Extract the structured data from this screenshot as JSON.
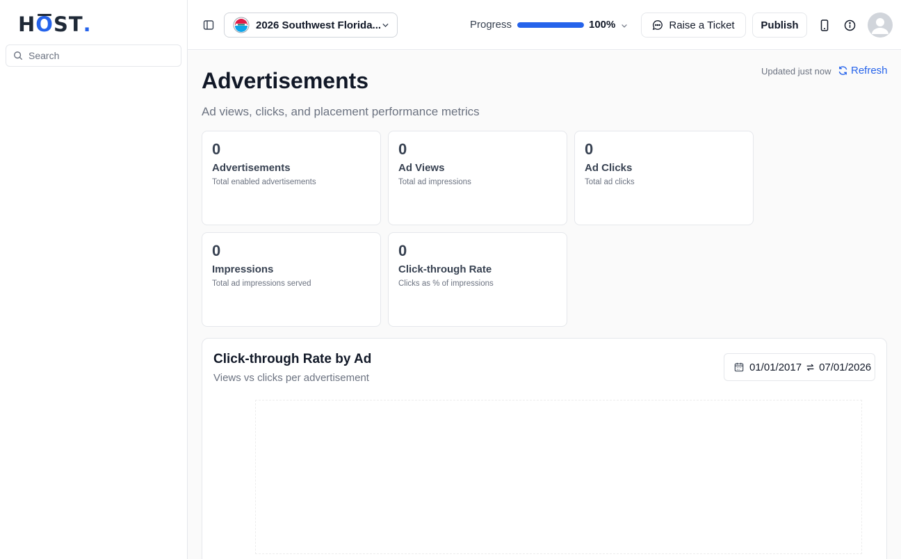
{
  "brand": {
    "logo_h": "H",
    "logo_o": "O",
    "logo_st": "ST",
    "logo_dot": "."
  },
  "sidebar": {
    "search_placeholder": "Search"
  },
  "topbar": {
    "project_name": "2026 Southwest Florida...",
    "progress_label": "Progress",
    "progress_value": "100%",
    "progress_fraction": 1.0,
    "raise_ticket_label": "Raise a Ticket",
    "publish_label": "Publish"
  },
  "page": {
    "title": "Advertisements",
    "subtitle": "Ad views, clicks, and placement performance metrics",
    "updated_text": "Updated just now",
    "refresh_label": "Refresh"
  },
  "cards": [
    {
      "value": "0",
      "title": "Advertisements",
      "desc": "Total enabled advertisements"
    },
    {
      "value": "0",
      "title": "Ad Views",
      "desc": "Total ad impressions"
    },
    {
      "value": "0",
      "title": "Ad Clicks",
      "desc": "Total ad clicks"
    },
    {
      "value": "0",
      "title": "Impressions",
      "desc": "Total ad impressions served"
    },
    {
      "value": "0",
      "title": "Click-through Rate",
      "desc": "Clicks as % of impressions"
    }
  ],
  "chart": {
    "title": "Click-through Rate by Ad",
    "subtitle": "Views vs clicks per advertisement",
    "date_start": "01/01/2017",
    "date_end": "07/01/2026"
  },
  "colors": {
    "accent": "#2563eb",
    "text": "#111827",
    "muted": "#6b7280",
    "border": "#e5e7eb"
  },
  "icons": [
    "search-icon",
    "sidebar-toggle-icon",
    "chevron-down-icon",
    "chat-bubble-icon",
    "mobile-device-icon",
    "info-icon",
    "user-avatar-icon",
    "refresh-icon",
    "calendar-icon",
    "swap-arrows-icon"
  ]
}
